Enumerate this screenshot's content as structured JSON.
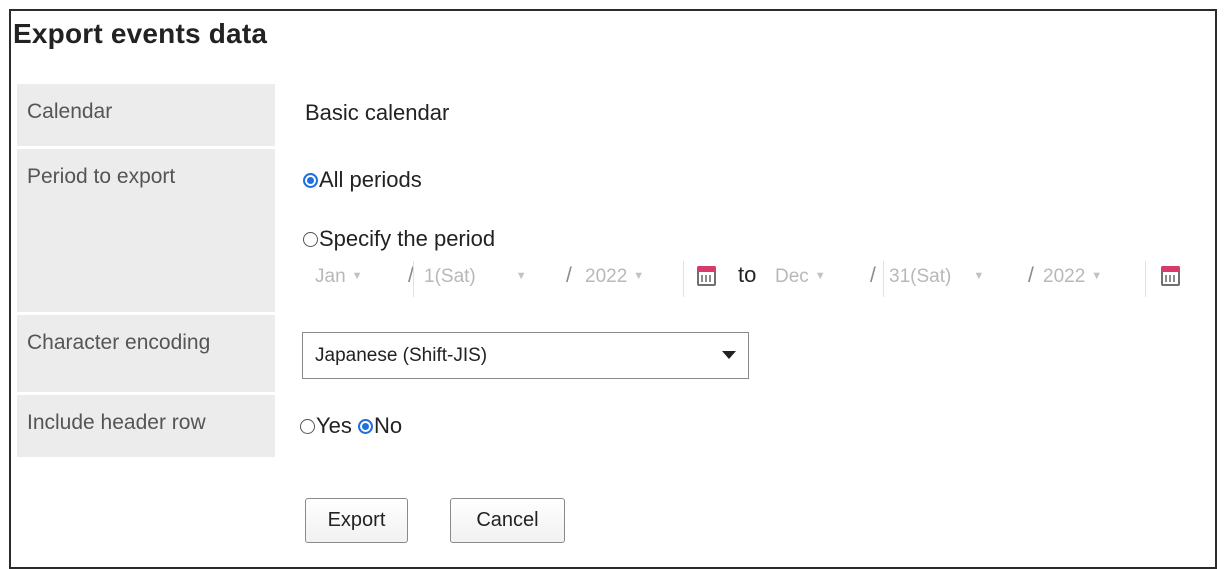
{
  "dialog": {
    "title": "Export events data"
  },
  "fields": {
    "calendar": {
      "label": "Calendar",
      "value": "Basic calendar"
    },
    "period": {
      "label": "Period to export",
      "option_all": "All periods",
      "option_specify": "Specify the period",
      "selected": "all",
      "start": {
        "month": "Jan",
        "day": "1(Sat)",
        "year": "2022"
      },
      "to": "to",
      "end": {
        "month": "Dec",
        "day": "31(Sat)",
        "year": "2022"
      },
      "separator": "/"
    },
    "encoding": {
      "label": "Character encoding",
      "value": "Japanese (Shift-JIS)"
    },
    "header_row": {
      "label": "Include header row",
      "option_yes": "Yes",
      "option_no": "No",
      "selected": "no"
    }
  },
  "buttons": {
    "export": "Export",
    "cancel": "Cancel"
  },
  "colors": {
    "radio_selected": "#1f6fe0",
    "label_bg": "#ececec",
    "calendar_icon_top": "#d63b6b"
  }
}
